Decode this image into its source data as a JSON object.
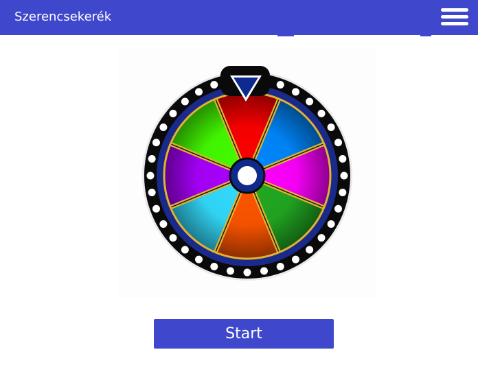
{
  "header": {
    "title": "Szerencsekerék",
    "menu_icon": "hamburger-menu-icon",
    "background": "#3f48cc"
  },
  "wheel": {
    "segment_count": 8,
    "segment_colors": [
      "#ff0000",
      "#0088ff",
      "#ff00ff",
      "#22aa22",
      "#ff5500",
      "#33ddff",
      "#aa00ff",
      "#44ff00"
    ],
    "rim_color": "#0a0a0a",
    "divider_color": "#e3b22e",
    "hub_color": "#102a8a",
    "pointer_color": "#0d2a8f",
    "icon": "prize-wheel-icon"
  },
  "actions": {
    "start_label": "Start"
  }
}
